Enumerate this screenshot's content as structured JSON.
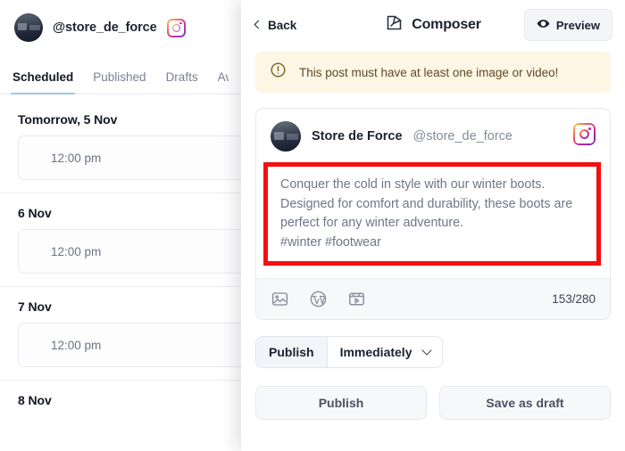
{
  "sidebar": {
    "account": {
      "handle": "@store_de_force",
      "network_icon": "instagram-icon"
    },
    "tabs": [
      {
        "label": "Scheduled",
        "active": true
      },
      {
        "label": "Published",
        "active": false
      },
      {
        "label": "Drafts",
        "active": false
      },
      {
        "label": "Av",
        "active": false
      }
    ],
    "days": [
      {
        "label": "Tomorrow, 5 Nov",
        "slots": [
          {
            "time": "12:00 pm"
          }
        ]
      },
      {
        "label": "6 Nov",
        "slots": [
          {
            "time": "12:00 pm"
          }
        ]
      },
      {
        "label": "7 Nov",
        "slots": [
          {
            "time": "12:00 pm"
          }
        ]
      },
      {
        "label": "8 Nov",
        "slots": []
      }
    ]
  },
  "composer": {
    "back_label": "Back",
    "title": "Composer",
    "title_icon": "compose-pen-icon",
    "preview_label": "Preview",
    "preview_icon": "eye-icon",
    "alert": {
      "icon": "exclamation-circle-icon",
      "text": "This post must have at least one image or video!",
      "background": "#fdf6e5"
    },
    "post": {
      "author_name": "Store de Force",
      "author_handle": "@store_de_force",
      "network_icon": "instagram-icon",
      "text": "Conquer the cold in style with our winter boots. Designed for comfort and durability, these boots are perfect for any winter adventure.\n#winter #footwear",
      "highlight_color": "#f40f11"
    },
    "toolbar": {
      "icons": [
        "image-icon",
        "wordpress-icon",
        "video-icon"
      ],
      "char_count": "153/280"
    },
    "publish_row": {
      "label": "Publish",
      "selected_option": "Immediately",
      "chevron_icon": "chevron-down-icon"
    },
    "actions": [
      {
        "label": "Publish"
      },
      {
        "label": "Save as draft"
      }
    ]
  }
}
